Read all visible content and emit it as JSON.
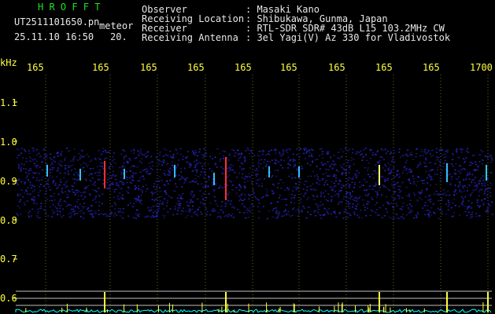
{
  "header": {
    "brand": "H R O F F T",
    "filename": "UT2511101650.pn",
    "mode": "meteor",
    "datetime": "25.11.10 16:50",
    "count": "20.",
    "fields": [
      {
        "label": "Observer",
        "value": ": Masaki Kano"
      },
      {
        "label": "Receiving Location",
        "value": ": Shibukawa, Gunma, Japan"
      },
      {
        "label": "Receiver",
        "value": ": RTL-SDR SDR# 43dB L15 103.2MHz CW"
      },
      {
        "label": "Receiving Antenna",
        "value": ": 3el Yagi(V) Az 330 for Vladivostok"
      }
    ]
  },
  "time_axis": {
    "ticks": [
      "165",
      "165",
      "165",
      "165",
      "165",
      "165",
      "165",
      "165",
      "165",
      "1700"
    ]
  },
  "freq_axis": {
    "unit": "kHz",
    "ticks": [
      "1.1",
      "1.0",
      "0.9",
      "0.8",
      "0.7",
      "0.6"
    ]
  },
  "colors": {
    "background": "#000000",
    "text": "#e8e8e8",
    "accent": "#ffff40",
    "brand": "#22e022",
    "noise": "#1a1aa0",
    "meteor": "#ff3030",
    "spectrum": "#00ffff"
  }
}
